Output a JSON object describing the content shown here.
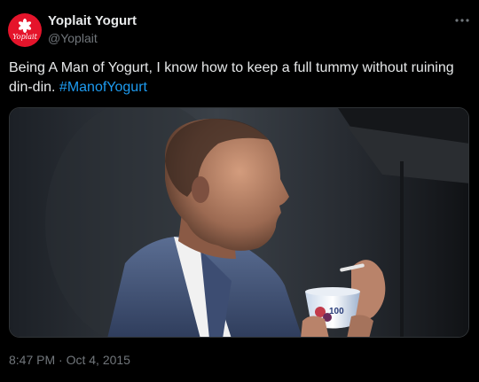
{
  "author": {
    "name": "Yoplait Yogurt",
    "handle": "@Yoplait",
    "avatar_text": "Yoplait"
  },
  "tweet": {
    "text_main": "Being A Man of Yogurt, I know how to keep a full tummy without ruining din-din. ",
    "hashtag": "#ManofYogurt"
  },
  "media": {
    "cup_label": "100"
  },
  "timestamp": {
    "time": "8:47 PM",
    "separator": " · ",
    "date": "Oct 4, 2015"
  },
  "colors": {
    "background": "#000000",
    "text": "#e7e9ea",
    "muted": "#71767b",
    "link": "#1d9bf0",
    "brand": "#e5142b"
  },
  "icons": {
    "more": "more-icon",
    "avatar_flower": "flower-icon"
  }
}
